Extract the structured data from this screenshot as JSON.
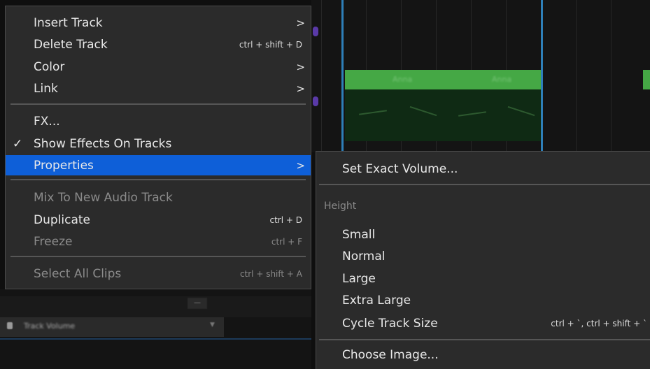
{
  "main_menu": {
    "items": [
      {
        "label": "Insert Track",
        "shortcut": "",
        "submenu": true,
        "checked": false,
        "disabled": false
      },
      {
        "label": "Delete Track",
        "shortcut": "ctrl + shift + D",
        "submenu": false,
        "checked": false,
        "disabled": false
      },
      {
        "label": "Color",
        "shortcut": "",
        "submenu": true,
        "checked": false,
        "disabled": false
      },
      {
        "label": "Link",
        "shortcut": "",
        "submenu": true,
        "checked": false,
        "disabled": false
      },
      {
        "label": "FX...",
        "shortcut": "",
        "submenu": false,
        "checked": false,
        "disabled": false
      },
      {
        "label": "Show Effects On Tracks",
        "shortcut": "",
        "submenu": false,
        "checked": true,
        "disabled": false
      },
      {
        "label": "Properties",
        "shortcut": "",
        "submenu": true,
        "checked": false,
        "disabled": false,
        "highlighted": true
      },
      {
        "label": "Mix To New Audio Track",
        "shortcut": "",
        "submenu": false,
        "checked": false,
        "disabled": true
      },
      {
        "label": "Duplicate",
        "shortcut": "ctrl + D",
        "submenu": false,
        "checked": false,
        "disabled": false
      },
      {
        "label": "Freeze",
        "shortcut": "ctrl + F",
        "submenu": false,
        "checked": false,
        "disabled": true
      },
      {
        "label": "Select All Clips",
        "shortcut": "ctrl + shift + A",
        "submenu": false,
        "checked": false,
        "disabled": true
      }
    ],
    "check_glyph": "✓",
    "arrow_glyph": ">"
  },
  "sub_menu": {
    "set_exact_volume": "Set Exact Volume...",
    "height_header": "Height",
    "small": "Small",
    "normal": "Normal",
    "large": "Large",
    "extra_large": "Extra Large",
    "cycle_track_size": "Cycle Track Size",
    "cycle_shortcut": "ctrl + `, ctrl + shift + `",
    "choose_image": "Choose Image..."
  },
  "background": {
    "clip_label": "Anna",
    "track_volume_label": "Track Volume"
  },
  "colors": {
    "menu_bg": "#2b2b2b",
    "highlight": "#0e5fd8",
    "clip_green": "#45a845",
    "marker_blue": "#2e7fb8"
  }
}
